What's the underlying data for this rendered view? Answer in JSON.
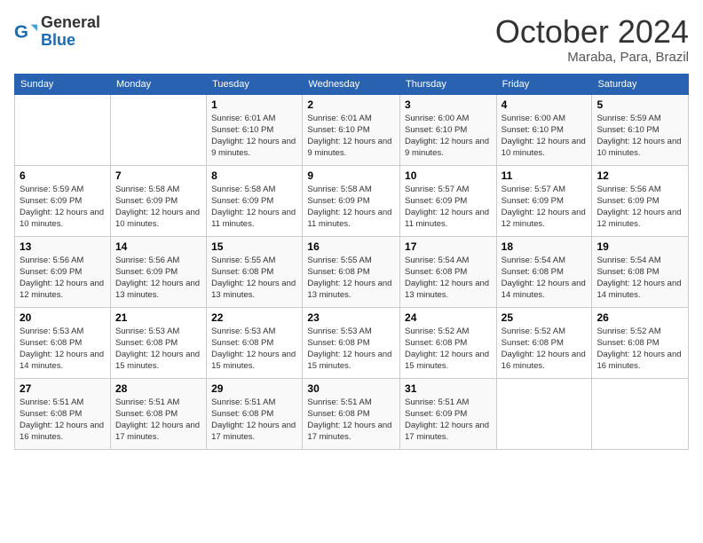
{
  "logo": {
    "line1": "General",
    "line2": "Blue"
  },
  "header": {
    "month": "October 2024",
    "location": "Maraba, Para, Brazil"
  },
  "weekdays": [
    "Sunday",
    "Monday",
    "Tuesday",
    "Wednesday",
    "Thursday",
    "Friday",
    "Saturday"
  ],
  "weeks": [
    [
      {
        "day": "",
        "info": ""
      },
      {
        "day": "",
        "info": ""
      },
      {
        "day": "1",
        "info": "Sunrise: 6:01 AM\nSunset: 6:10 PM\nDaylight: 12 hours and 9 minutes."
      },
      {
        "day": "2",
        "info": "Sunrise: 6:01 AM\nSunset: 6:10 PM\nDaylight: 12 hours and 9 minutes."
      },
      {
        "day": "3",
        "info": "Sunrise: 6:00 AM\nSunset: 6:10 PM\nDaylight: 12 hours and 9 minutes."
      },
      {
        "day": "4",
        "info": "Sunrise: 6:00 AM\nSunset: 6:10 PM\nDaylight: 12 hours and 10 minutes."
      },
      {
        "day": "5",
        "info": "Sunrise: 5:59 AM\nSunset: 6:10 PM\nDaylight: 12 hours and 10 minutes."
      }
    ],
    [
      {
        "day": "6",
        "info": "Sunrise: 5:59 AM\nSunset: 6:09 PM\nDaylight: 12 hours and 10 minutes."
      },
      {
        "day": "7",
        "info": "Sunrise: 5:58 AM\nSunset: 6:09 PM\nDaylight: 12 hours and 10 minutes."
      },
      {
        "day": "8",
        "info": "Sunrise: 5:58 AM\nSunset: 6:09 PM\nDaylight: 12 hours and 11 minutes."
      },
      {
        "day": "9",
        "info": "Sunrise: 5:58 AM\nSunset: 6:09 PM\nDaylight: 12 hours and 11 minutes."
      },
      {
        "day": "10",
        "info": "Sunrise: 5:57 AM\nSunset: 6:09 PM\nDaylight: 12 hours and 11 minutes."
      },
      {
        "day": "11",
        "info": "Sunrise: 5:57 AM\nSunset: 6:09 PM\nDaylight: 12 hours and 12 minutes."
      },
      {
        "day": "12",
        "info": "Sunrise: 5:56 AM\nSunset: 6:09 PM\nDaylight: 12 hours and 12 minutes."
      }
    ],
    [
      {
        "day": "13",
        "info": "Sunrise: 5:56 AM\nSunset: 6:09 PM\nDaylight: 12 hours and 12 minutes."
      },
      {
        "day": "14",
        "info": "Sunrise: 5:56 AM\nSunset: 6:09 PM\nDaylight: 12 hours and 13 minutes."
      },
      {
        "day": "15",
        "info": "Sunrise: 5:55 AM\nSunset: 6:08 PM\nDaylight: 12 hours and 13 minutes."
      },
      {
        "day": "16",
        "info": "Sunrise: 5:55 AM\nSunset: 6:08 PM\nDaylight: 12 hours and 13 minutes."
      },
      {
        "day": "17",
        "info": "Sunrise: 5:54 AM\nSunset: 6:08 PM\nDaylight: 12 hours and 13 minutes."
      },
      {
        "day": "18",
        "info": "Sunrise: 5:54 AM\nSunset: 6:08 PM\nDaylight: 12 hours and 14 minutes."
      },
      {
        "day": "19",
        "info": "Sunrise: 5:54 AM\nSunset: 6:08 PM\nDaylight: 12 hours and 14 minutes."
      }
    ],
    [
      {
        "day": "20",
        "info": "Sunrise: 5:53 AM\nSunset: 6:08 PM\nDaylight: 12 hours and 14 minutes."
      },
      {
        "day": "21",
        "info": "Sunrise: 5:53 AM\nSunset: 6:08 PM\nDaylight: 12 hours and 15 minutes."
      },
      {
        "day": "22",
        "info": "Sunrise: 5:53 AM\nSunset: 6:08 PM\nDaylight: 12 hours and 15 minutes."
      },
      {
        "day": "23",
        "info": "Sunrise: 5:53 AM\nSunset: 6:08 PM\nDaylight: 12 hours and 15 minutes."
      },
      {
        "day": "24",
        "info": "Sunrise: 5:52 AM\nSunset: 6:08 PM\nDaylight: 12 hours and 15 minutes."
      },
      {
        "day": "25",
        "info": "Sunrise: 5:52 AM\nSunset: 6:08 PM\nDaylight: 12 hours and 16 minutes."
      },
      {
        "day": "26",
        "info": "Sunrise: 5:52 AM\nSunset: 6:08 PM\nDaylight: 12 hours and 16 minutes."
      }
    ],
    [
      {
        "day": "27",
        "info": "Sunrise: 5:51 AM\nSunset: 6:08 PM\nDaylight: 12 hours and 16 minutes."
      },
      {
        "day": "28",
        "info": "Sunrise: 5:51 AM\nSunset: 6:08 PM\nDaylight: 12 hours and 17 minutes."
      },
      {
        "day": "29",
        "info": "Sunrise: 5:51 AM\nSunset: 6:08 PM\nDaylight: 12 hours and 17 minutes."
      },
      {
        "day": "30",
        "info": "Sunrise: 5:51 AM\nSunset: 6:08 PM\nDaylight: 12 hours and 17 minutes."
      },
      {
        "day": "31",
        "info": "Sunrise: 5:51 AM\nSunset: 6:09 PM\nDaylight: 12 hours and 17 minutes."
      },
      {
        "day": "",
        "info": ""
      },
      {
        "day": "",
        "info": ""
      }
    ]
  ]
}
